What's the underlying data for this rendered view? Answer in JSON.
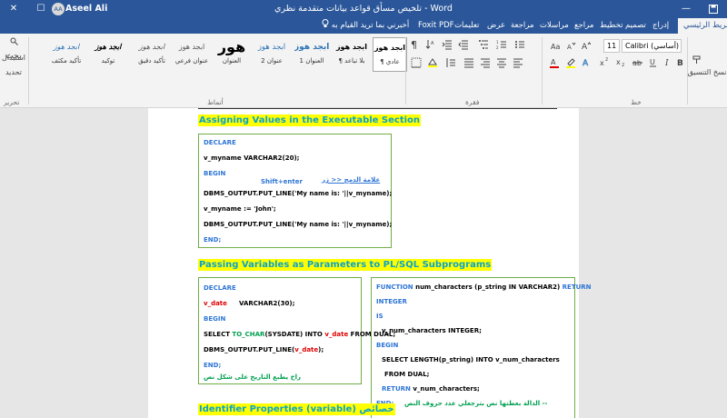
{
  "window": {
    "title": "تلخيص مسأق قواعد بيانات متقدمة نظري  -  Word",
    "user_name": "Aseel Ali",
    "user_initials": "AA",
    "controls": {
      "close": "✕",
      "maximize": "☐",
      "minimize": "—"
    }
  },
  "menu": {
    "tabs": [
      "شريط الرئيسي",
      "إدراج",
      "تصميم",
      "تخطيط",
      "مراجع",
      "مراسلات",
      "مراجعة",
      "عرض",
      "تعليمات",
      "Foxit PDF"
    ],
    "tell_me": "أخبرني بما تريد القيام به"
  },
  "ribbon": {
    "styles": [
      {
        "sample": "ابجد هوز",
        "name": "¶ عادي"
      },
      {
        "sample": "ابجد هوز",
        "name": "¶ بلا تباعد"
      },
      {
        "sample": "ابجد هوز",
        "name": "العنوان 1"
      },
      {
        "sample": "ابجد هوز",
        "name": "عنوان 2"
      },
      {
        "sample": "هور",
        "name": "العنوان"
      },
      {
        "sample": "ابجد هوز",
        "name": "عنوان فرعي"
      },
      {
        "sample": "ابجد هوز",
        "name": "تأكيد دقيق"
      },
      {
        "sample": "ابجد هوز",
        "name": "توكيد"
      },
      {
        "sample": "ابجد هوز",
        "name": "تأكيد مكثف"
      }
    ],
    "group_styles": "أنماط",
    "group_paragraph": "فقرة",
    "group_font": "خط",
    "font_name": "Calibri (أساسي)",
    "font_size": "11",
    "clipboard_label": "نسخ التنسيق",
    "editing": {
      "find": "بحث",
      "replace": "استبدال",
      "select": "تحديد",
      "group": "تحرير"
    }
  },
  "document": {
    "section1": {
      "heading": "Assigning Values in the Executable Section",
      "lines": {
        "declare": "DECLARE",
        "var": "v_myname     VARCHAR2(20);",
        "begin": "BEGIN",
        "annotation_ar": "علامة الدمج <<  زر",
        "annotation_key": "Shift+enter",
        "put1": "DBMS_OUTPUT.PUT_LINE('My name is: '||v_myname);",
        "assign": "v_myname := 'John';",
        "put2": "DBMS_OUTPUT.PUT_LINE('My name is: '||v_myname);",
        "end": "END;"
      }
    },
    "section2": {
      "heading": "Passing Variables as Parameters to PL/SQL Subprograms",
      "left": {
        "declare": "DECLARE",
        "var_name": "v_date",
        "var_type": "VARCHAR2(30);",
        "begin": "BEGIN",
        "select_a": "SELECT ",
        "select_fn": "TO_CHAR",
        "select_b": "(SYSDATE) INTO ",
        "select_var": "v_date",
        "select_c": " FROM DUAL;",
        "put_a": "DBMS_OUTPUT.PUT_LINE(",
        "put_var": "v_date",
        "put_b": ");",
        "end": "END;",
        "note": "راح يطبع التاريخ على شكل نص"
      },
      "right": {
        "fn_kw": "FUNCTION",
        "fn_sig": " num_characters (p_string IN VARCHAR2) ",
        "fn_ret": "RETURN",
        "integer": "INTEGER",
        "is": "IS",
        "var": "v_num_characters          INTEGER;",
        "begin": "BEGIN",
        "select": "SELECT LENGTH(p_string) INTO v_num_characters",
        "from": "FROM DUAL;",
        "ret_kw": "RETURN",
        "ret_var": " v_num_characters;",
        "end": "END;",
        "note": "الدالة بعطتها نص بترجعلي عدد حروف النص --"
      }
    },
    "section3": {
      "heading": "Identifier Properties   (variable)",
      "heading_ar": "خصائص"
    }
  }
}
